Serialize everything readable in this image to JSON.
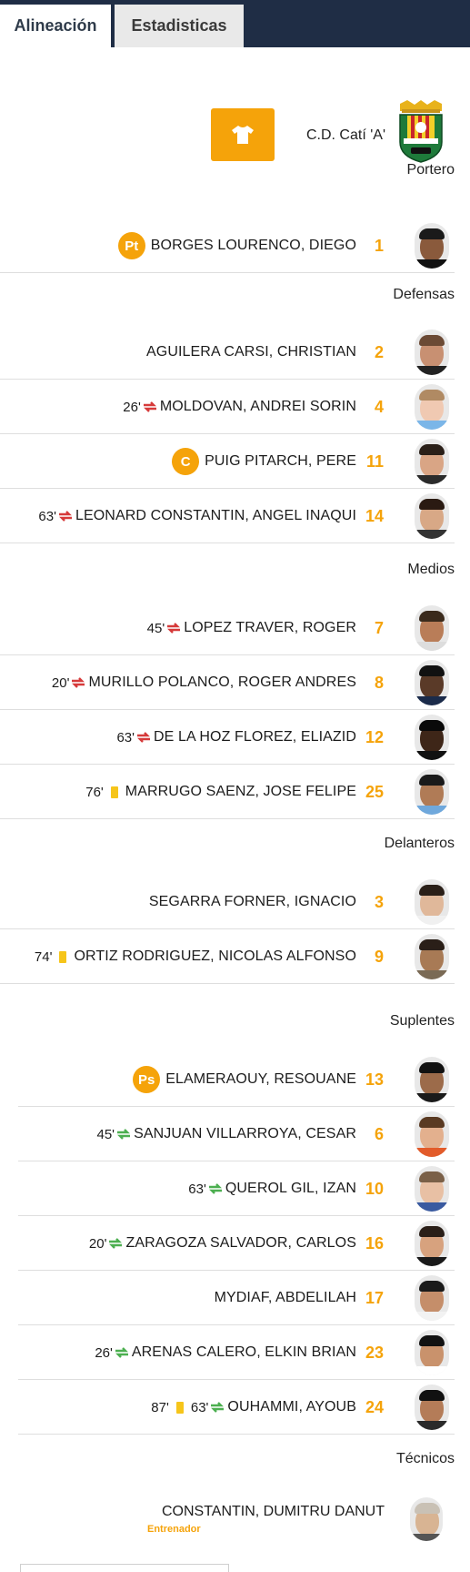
{
  "tabs": {
    "lineup": "Alineación",
    "stats": "Estadisticas"
  },
  "team": {
    "name": "C.D. Catí 'A'"
  },
  "colors": {
    "accent": "#f5a30a",
    "sub_out": "#d63a3a",
    "sub_in": "#4caf50",
    "yellow_card": "#f6c51a",
    "header_bg": "#1f2d45"
  },
  "sections": {
    "goalkeeper": "Portero",
    "defenders": "Defensas",
    "midfielders": "Medios",
    "forwards": "Delanteros",
    "subs": "Suplentes",
    "staff": "Técnicos"
  },
  "players": {
    "p1": {
      "name": "BORGES LOURENCO, DIEGO",
      "number": "1",
      "badge": "Pt"
    },
    "p2": {
      "name": "AGUILERA CARSI, CHRISTIAN",
      "number": "2"
    },
    "p4": {
      "name": "MOLDOVAN, ANDREI SORIN",
      "number": "4",
      "minute": "26'"
    },
    "p11": {
      "name": "PUIG PITARCH, PERE",
      "number": "11",
      "badge": "C"
    },
    "p14": {
      "name": "LEONARD CONSTANTIN, ANGEL INAQUI",
      "number": "14",
      "minute": "63'"
    },
    "p7": {
      "name": "LOPEZ TRAVER, ROGER",
      "number": "7",
      "minute": "45'"
    },
    "p8": {
      "name": "MURILLO POLANCO, ROGER ANDRES",
      "number": "8",
      "minute": "20'"
    },
    "p12": {
      "name": "DE LA HOZ FLOREZ, ELIAZID",
      "number": "12",
      "minute": "63'"
    },
    "p25": {
      "name": "MARRUGO SAENZ, JOSE FELIPE",
      "number": "25",
      "card_minute": "76'"
    },
    "p3": {
      "name": "SEGARRA FORNER, IGNACIO",
      "number": "3"
    },
    "p9": {
      "name": "ORTIZ RODRIGUEZ, NICOLAS ALFONSO",
      "number": "9",
      "card_minute": "74'"
    },
    "s13": {
      "name": "ELAMERAOUY, RESOUANE",
      "number": "13",
      "badge": "Ps"
    },
    "s6": {
      "name": "SANJUAN VILLARROYA, CESAR",
      "number": "6",
      "minute": "45'"
    },
    "s10": {
      "name": "QUEROL GIL, IZAN",
      "number": "10",
      "minute": "63'"
    },
    "s16": {
      "name": "ZARAGOZA SALVADOR, CARLOS",
      "number": "16",
      "minute": "20'"
    },
    "s17": {
      "name": "MYDIAF, ABDELILAH",
      "number": "17"
    },
    "s23": {
      "name": "ARENAS CALERO, ELKIN BRIAN",
      "number": "23",
      "minute": "26'"
    },
    "s24": {
      "name": "OUHAMMI, AYOUB",
      "number": "24",
      "minute": "63'",
      "card_minute": "87'"
    }
  },
  "coach": {
    "name": "CONSTANTIN, DUMITRU DANUT",
    "role": "Entrenador"
  }
}
